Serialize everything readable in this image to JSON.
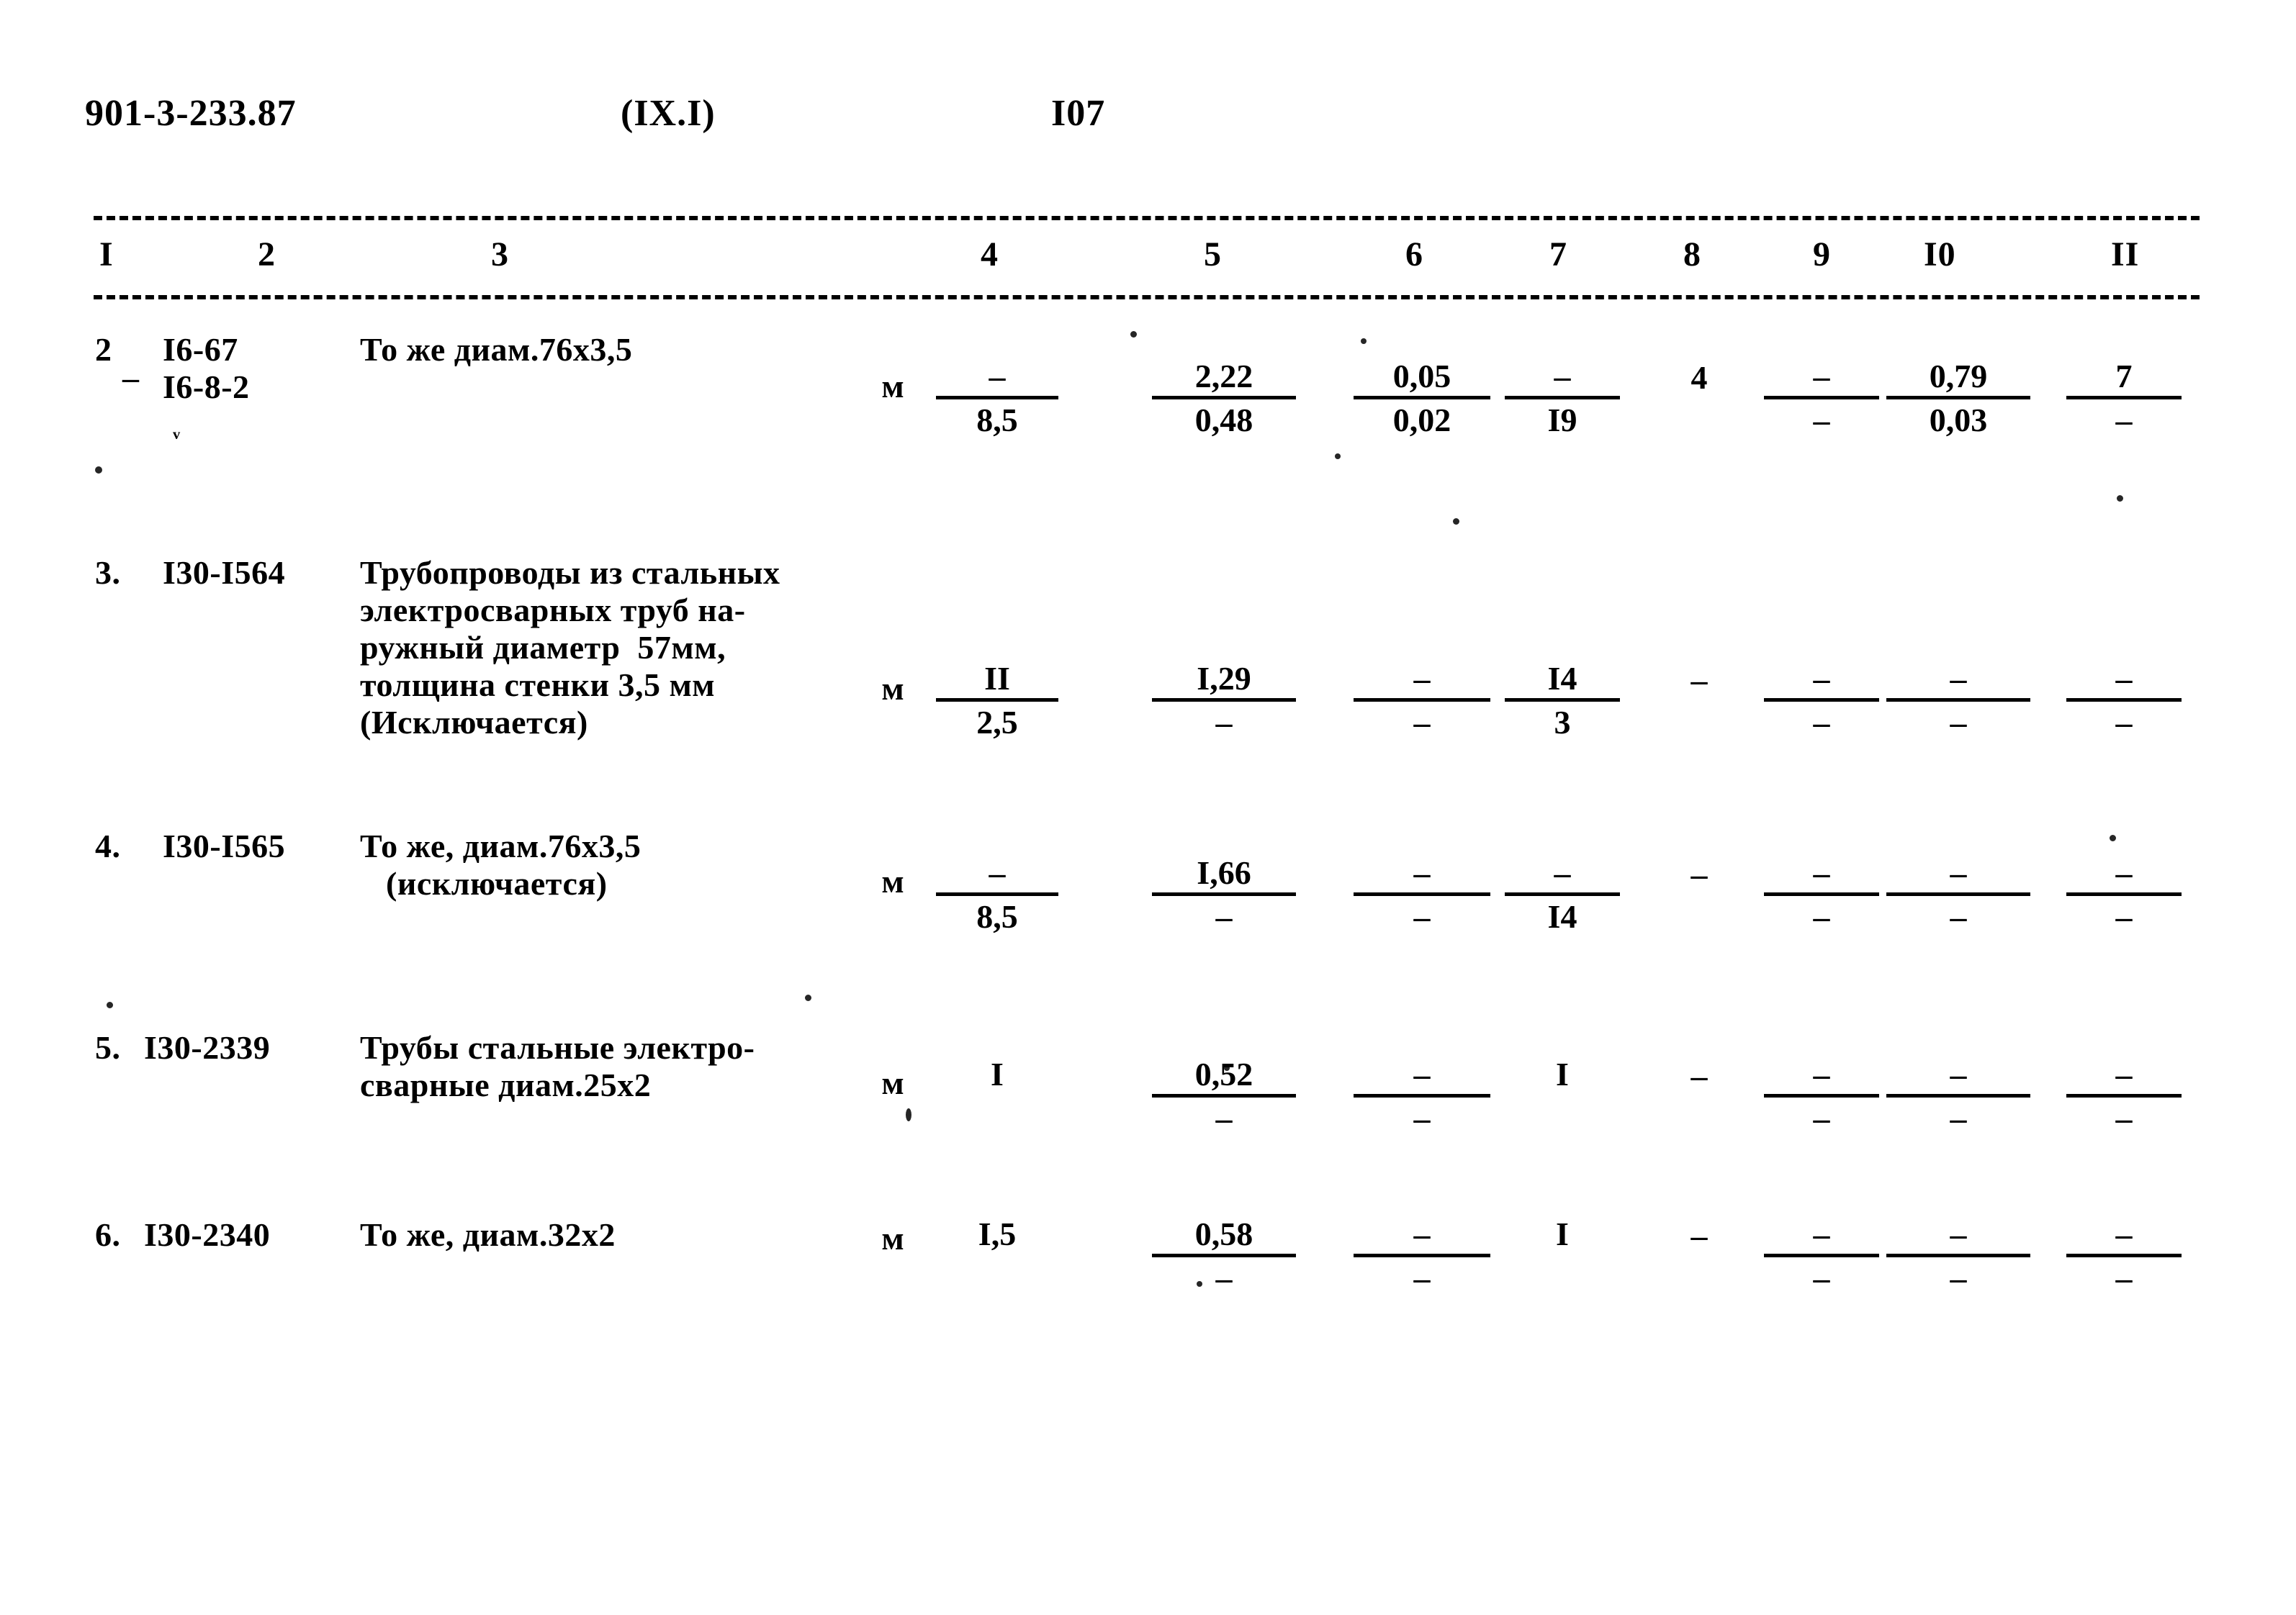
{
  "header": {
    "doc_number": "901-3-233.87",
    "section_code": "(IX.I)",
    "page_number": "I07"
  },
  "table": {
    "column_headers": [
      "I",
      "2",
      "3",
      "4",
      "5",
      "6",
      "7",
      "8",
      "9",
      "I0",
      "II"
    ],
    "rows": [
      {
        "item_no": "2",
        "code_line1": "I6-67",
        "code_line2": "I6-8-2",
        "desc_lines": [
          "То же диам.76х3,5"
        ],
        "unit": "м",
        "c4_num": "–",
        "c4_den": "8,5",
        "c5_num": "2,22",
        "c5_den": "0,48",
        "c6_num": "0,05",
        "c6_den": "0,02",
        "c7_num": "–",
        "c7_den": "I9",
        "c8": "4",
        "c9_num": "–",
        "c9_den": "–",
        "c10_num": "0,79",
        "c10_den": "0,03",
        "c11_num": "7",
        "c11_den": "–"
      },
      {
        "item_no": "3.",
        "code_line1": "I30-I564",
        "code_line2": "",
        "desc_lines": [
          "Трубопроводы из стальных",
          "электросварных труб на-",
          "ружный диаметр  57мм,",
          "толщина стенки 3,5 мм",
          "(Исключается)"
        ],
        "unit": "м",
        "c4_num": "II",
        "c4_den": "2,5",
        "c5_num": "I,29",
        "c5_den": "–",
        "c6_num": "–",
        "c6_den": "–",
        "c7_num": "I4",
        "c7_den": "3",
        "c8": "–",
        "c9_num": "–",
        "c9_den": "–",
        "c10_num": "–",
        "c10_den": "–",
        "c11_num": "–",
        "c11_den": "–"
      },
      {
        "item_no": "4.",
        "code_line1": "I30-I565",
        "code_line2": "",
        "desc_lines": [
          "То же, диам.76х3,5",
          "   (исключается)"
        ],
        "unit": "м",
        "c4_num": "–",
        "c4_den": "8,5",
        "c5_num": "I,66",
        "c5_den": "–",
        "c6_num": "–",
        "c6_den": "–",
        "c7_num": "–",
        "c7_den": "I4",
        "c8": "–",
        "c9_num": "–",
        "c9_den": "–",
        "c10_num": "–",
        "c10_den": "–",
        "c11_num": "–",
        "c11_den": "–"
      },
      {
        "item_no": "5.",
        "code_line1": "I30-2339",
        "code_line2": "",
        "desc_lines": [
          "Трубы стальные электро-",
          "сварные диам.25х2"
        ],
        "unit": "м",
        "c4_num": "I",
        "c4_den": "",
        "c5_num": "0,52",
        "c5_den": "–",
        "c6_num": "–",
        "c6_den": "–",
        "c7_num": "I",
        "c7_den": "",
        "c8": "–",
        "c9_num": "–",
        "c9_den": "–",
        "c10_num": "–",
        "c10_den": "–",
        "c11_num": "–",
        "c11_den": "–"
      },
      {
        "item_no": "6.",
        "code_line1": "I30-2340",
        "code_line2": "",
        "desc_lines": [
          "То же, диам.32х2"
        ],
        "unit": "м",
        "c4_num": "I,5",
        "c4_den": "",
        "c5_num": "0,58",
        "c5_den": "–",
        "c6_num": "–",
        "c6_den": "–",
        "c7_num": "I",
        "c7_den": "",
        "c8": "–",
        "c9_num": "–",
        "c9_den": "–",
        "c10_num": "–",
        "c10_den": "–",
        "c11_num": "–",
        "c11_den": "–"
      }
    ]
  }
}
